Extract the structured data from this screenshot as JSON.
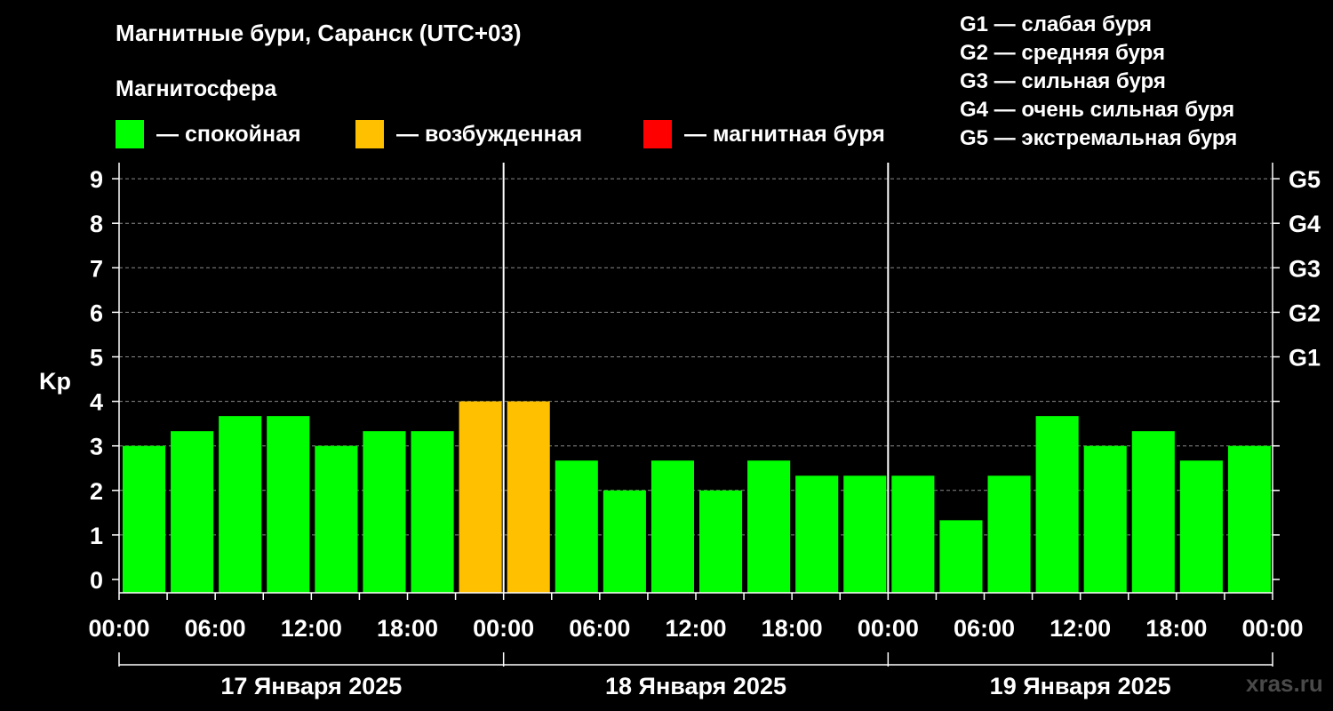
{
  "header": {
    "title": "Магнитные бури, Саранск (UTC+03)",
    "subtitle": "Магнитосфера"
  },
  "legend": [
    {
      "label": "— спокойная",
      "color": "#00ff00"
    },
    {
      "label": "— возбужденная",
      "color": "#ffc000"
    },
    {
      "label": "— магнитная буря",
      "color": "#ff0000"
    }
  ],
  "storm_levels": [
    "G1 — слабая буря",
    "G2 — средняя буря",
    "G3 — сильная буря",
    "G4 — очень сильная буря",
    "G5 — экстремальная буря"
  ],
  "watermark": "xras.ru",
  "chart_data": {
    "type": "bar",
    "ylabel": "Kp",
    "ylim": [
      0,
      9
    ],
    "y_ticks": [
      "0",
      "1",
      "2",
      "3",
      "4",
      "5",
      "6",
      "7",
      "8",
      "9"
    ],
    "right_ticks": [
      {
        "value": 5,
        "label": "G1"
      },
      {
        "value": 6,
        "label": "G2"
      },
      {
        "value": 7,
        "label": "G3"
      },
      {
        "value": 8,
        "label": "G4"
      },
      {
        "value": 9,
        "label": "G5"
      }
    ],
    "grid": "horizontal dashed",
    "x_tick_labels": [
      "00:00",
      "06:00",
      "12:00",
      "18:00",
      "00:00",
      "06:00",
      "12:00",
      "18:00",
      "00:00",
      "06:00",
      "12:00",
      "18:00",
      "00:00"
    ],
    "days": [
      "17 Января 2025",
      "18 Января 2025",
      "19 Января 2025"
    ],
    "interval_hours": 3,
    "values": [
      3.0,
      3.33,
      3.67,
      3.67,
      3.0,
      3.33,
      3.33,
      4.0,
      4.0,
      2.67,
      2.0,
      2.67,
      2.0,
      2.67,
      2.33,
      2.33,
      2.33,
      1.33,
      2.33,
      3.67,
      3.0,
      3.33,
      2.67,
      3.0
    ],
    "colors": [
      "#00ff00",
      "#00ff00",
      "#00ff00",
      "#00ff00",
      "#00ff00",
      "#00ff00",
      "#00ff00",
      "#ffc000",
      "#ffc000",
      "#00ff00",
      "#00ff00",
      "#00ff00",
      "#00ff00",
      "#00ff00",
      "#00ff00",
      "#00ff00",
      "#00ff00",
      "#00ff00",
      "#00ff00",
      "#00ff00",
      "#00ff00",
      "#00ff00",
      "#00ff00",
      "#00ff00"
    ]
  }
}
